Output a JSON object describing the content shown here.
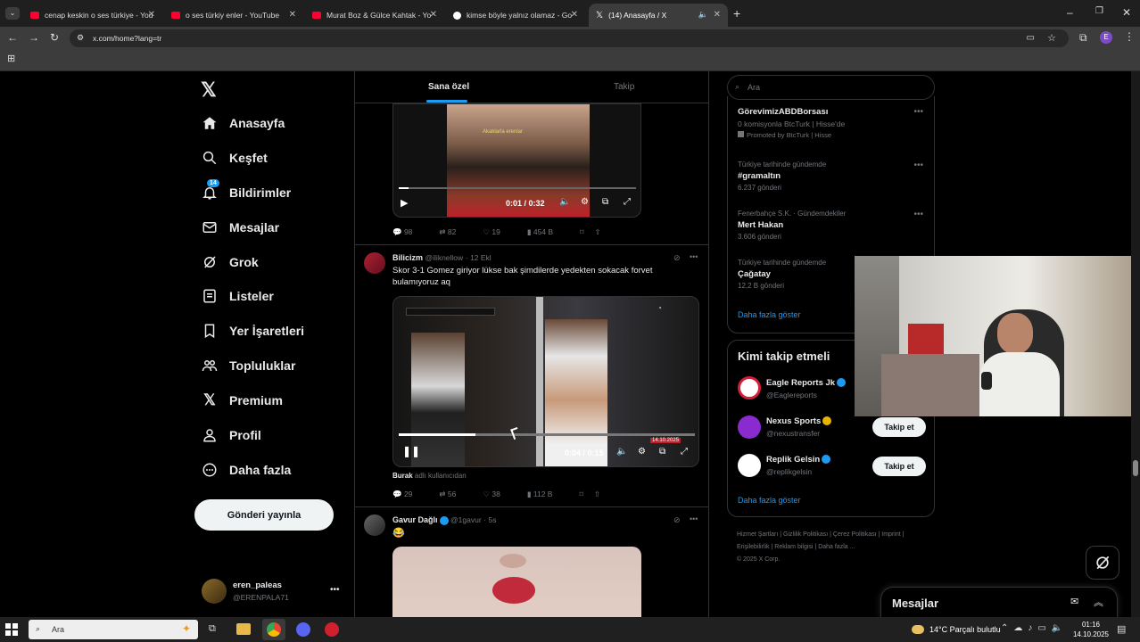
{
  "browser": {
    "tabs": [
      {
        "title": "cenap keskin o ses türkiye - You",
        "active": false
      },
      {
        "title": "o ses türkiy enler - YouTube",
        "active": false
      },
      {
        "title": "Murat Boz & Gülce Kahtak - Yo",
        "active": false
      },
      {
        "title": "kimse böyle yalnız olamaz - Go",
        "active": false
      },
      {
        "title": "(14) Anasayfa / X",
        "active": true
      }
    ],
    "url": "x.com/home?lang=tr",
    "profile_initial": "E"
  },
  "nav": {
    "items": [
      {
        "label": "Anasayfa",
        "icon": "home-icon"
      },
      {
        "label": "Keşfet",
        "icon": "search-icon"
      },
      {
        "label": "Bildirimler",
        "icon": "bell-icon"
      },
      {
        "label": "Mesajlar",
        "icon": "mail-icon"
      },
      {
        "label": "Grok",
        "icon": "grok-icon"
      },
      {
        "label": "Listeler",
        "icon": "list-icon"
      },
      {
        "label": "Yer İşaretleri",
        "icon": "bookmark-icon"
      },
      {
        "label": "Topluluklar",
        "icon": "people-icon"
      },
      {
        "label": "Premium",
        "icon": "x-logo-icon"
      },
      {
        "label": "Profil",
        "icon": "person-icon"
      },
      {
        "label": "Daha fazla",
        "icon": "more-circle-icon"
      }
    ],
    "notification_badge": "14",
    "post_button": "Gönderi yayınla",
    "account": {
      "name": "eren_paleas",
      "handle": "@ERENPALA71"
    }
  },
  "feed": {
    "tabs": [
      "Sana özel",
      "Takip"
    ],
    "tweet1": {
      "video_time": "0:01 / 0:32",
      "video_caption": "Akaklarla erenlar",
      "stats": {
        "replies": "98",
        "retweets": "82",
        "likes": "19",
        "views": "454 B"
      }
    },
    "tweet2": {
      "name": "Bilicizm",
      "handle": "@iliknellow",
      "time": "12 Ekl",
      "text": "Skor 3-1 Gomez giriyor lükse bak şimdilerde yedekten sokacak forvet bulamıyoruz aq",
      "video_time": "0:04 / 0:15",
      "video_date": "14.10.2025",
      "caption_user": "Burak",
      "caption_rest": "adlı kullanıcıdan",
      "stats": {
        "replies": "29",
        "retweets": "56",
        "likes": "38",
        "views": "112 B"
      }
    },
    "tweet3": {
      "name": "Gavur Dağlı",
      "handle": "@1gavur",
      "time": "5s",
      "emoji": "😂"
    }
  },
  "right": {
    "search_placeholder": "Ara",
    "trends": [
      {
        "meta": "",
        "title": "GörevimizABDBorsası",
        "sub": "0 komisyonla BtcTurk | Hisse'de",
        "sub2": "Promoted by BtcTurk | Hisse"
      },
      {
        "meta": "Türkiye tarihinde gündemde",
        "title": "#gramaltın",
        "sub": "6.237 gönderi"
      },
      {
        "meta": "Fenerbahçe S.K. · Gündemdekiler",
        "title": "Mert Hakan",
        "sub": "3.606 gönderi"
      },
      {
        "meta": "Türkiye tarihinde gündemde",
        "title": "Çağatay",
        "sub": "12,2 B gönderi"
      }
    ],
    "show_more": "Daha fazla göster",
    "who_to_follow_title": "Kimi takip etmeli",
    "follow": [
      {
        "name": "Eagle Reports Jk",
        "handle": "@Eaglereports",
        "button": ""
      },
      {
        "name": "Nexus Sports",
        "handle": "@nexustransfer",
        "button": "Takip et"
      },
      {
        "name": "Replik Gelsin",
        "handle": "@replikgelsin",
        "button": "Takip et"
      }
    ],
    "footer": [
      "Hizmet Şartları",
      "Gizlilik Politikası",
      "Çerez Politikası",
      "Imprint",
      "Erişilebilirlik",
      "Reklam bilgisi",
      "Daha fazla ...",
      "© 2025 X Corp."
    ],
    "messages_title": "Mesajlar"
  },
  "taskbar": {
    "search": "Ara",
    "weather": "14°C  Parçalı bulutlu",
    "time": "01:16",
    "date": "14.10.2025"
  }
}
